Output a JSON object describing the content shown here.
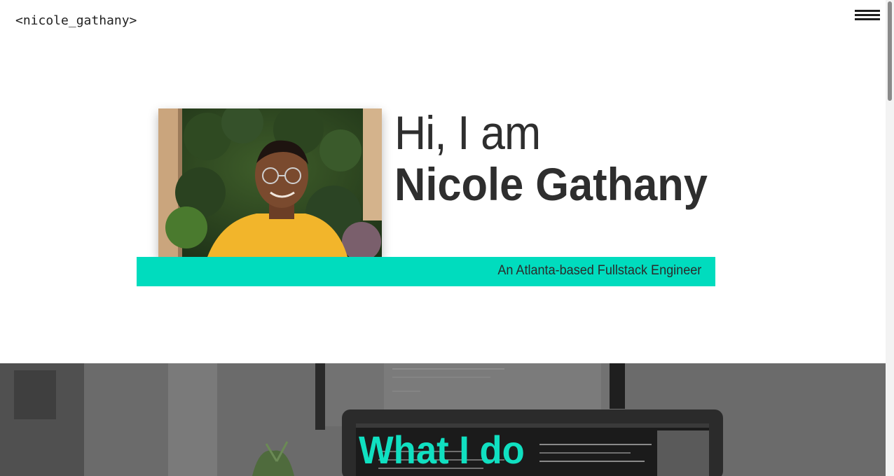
{
  "header": {
    "logo": "<nicole_gathany>",
    "menu_icon": "hamburger-menu-icon"
  },
  "hero": {
    "greeting": "Hi, I am",
    "name": "Nicole Gathany",
    "tagline": "An Atlanta-based Fullstack Engineer",
    "photo": "portrait-photo",
    "accent_color": "#00dcbe"
  },
  "section_what": {
    "title": "What I do",
    "title_color": "#10e0c1",
    "background": "laptop-code-background"
  }
}
